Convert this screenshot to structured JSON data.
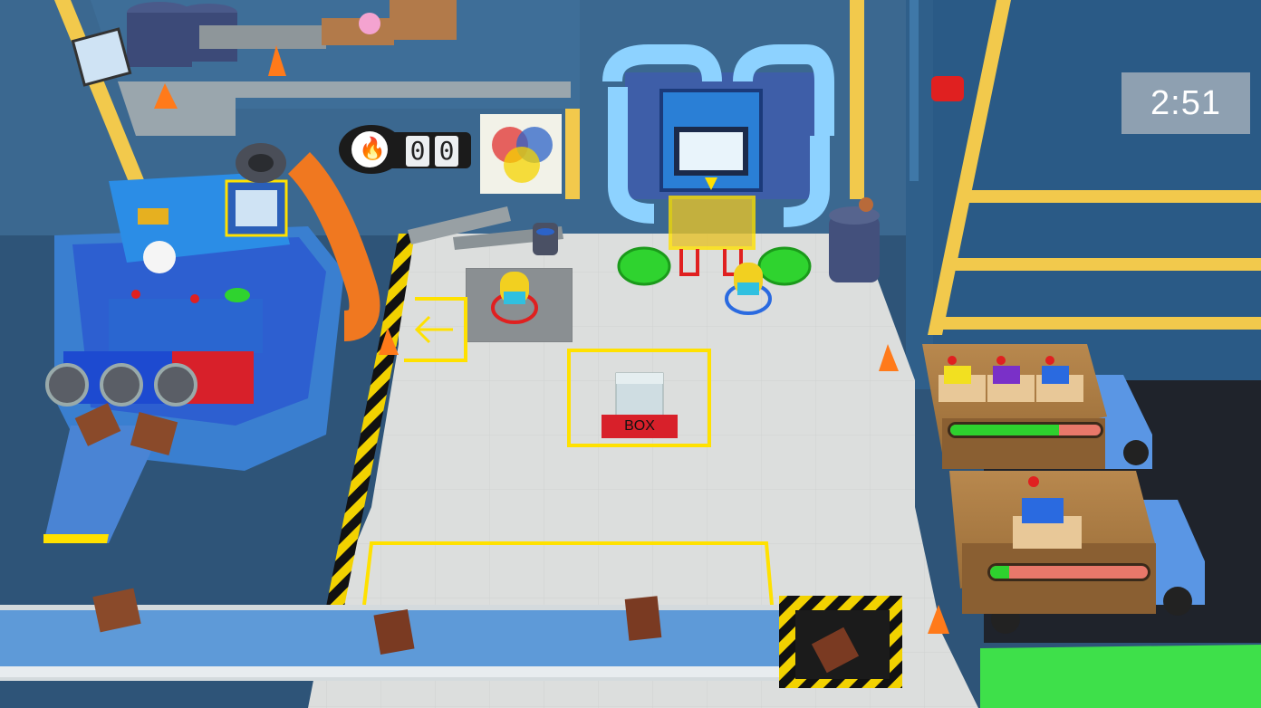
{
  "hud": {
    "timer": "2:51",
    "score_digits": [
      "0",
      "0"
    ],
    "score_icon": "flame-icon"
  },
  "station": {
    "box_label": "BOX"
  },
  "orders": [
    {
      "items": [
        "yellow-box",
        "purple-box",
        "blue-box"
      ],
      "progress": 0.72
    },
    {
      "items": [
        "blue-box"
      ],
      "progress": 0.12
    }
  ],
  "colors": {
    "wall": "#3d6a96",
    "floor": "#d9dcdc",
    "hazard_yellow": "#f5d400",
    "accent_red": "#d8202a",
    "progress_green": "#2ed12e",
    "progress_red": "#e8786a",
    "button_green": "#2fd32f"
  }
}
